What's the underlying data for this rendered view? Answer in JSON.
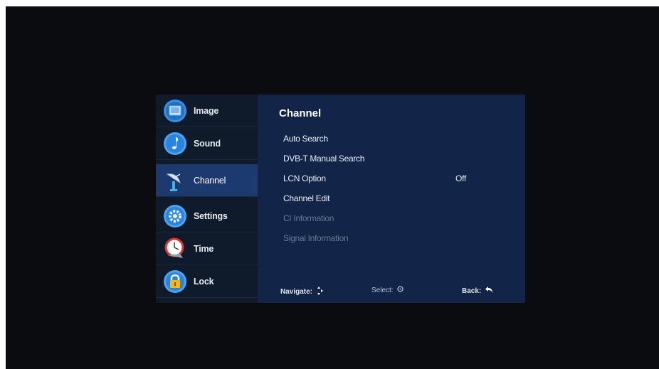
{
  "sidebar": {
    "items": [
      {
        "label": "Image",
        "icon": "image-icon"
      },
      {
        "label": "Sound",
        "icon": "music-note-icon"
      },
      {
        "label": "Channel",
        "icon": "satellite-dish-icon",
        "active": true
      },
      {
        "label": "Settings",
        "icon": "gear-icon"
      },
      {
        "label": "Time",
        "icon": "clock-icon"
      },
      {
        "label": "Lock",
        "icon": "padlock-icon"
      }
    ]
  },
  "main": {
    "title": "Channel",
    "items": [
      {
        "label": "Auto Search",
        "value": "",
        "enabled": true
      },
      {
        "label": "DVB-T Manual Search",
        "value": "",
        "enabled": true
      },
      {
        "label": "LCN Option",
        "value": "Off",
        "enabled": true
      },
      {
        "label": "Channel Edit",
        "value": "",
        "enabled": true
      },
      {
        "label": "CI Information",
        "value": "",
        "enabled": false
      },
      {
        "label": "Signal Information",
        "value": "",
        "enabled": false
      }
    ]
  },
  "footer": {
    "navigate_label": "Navigate:",
    "select_label": "Select:",
    "back_label": "Back:"
  },
  "colors": {
    "active_row": "#1c3a6e",
    "panel_bg": "#122447",
    "disabled_text": "#6a7793"
  }
}
